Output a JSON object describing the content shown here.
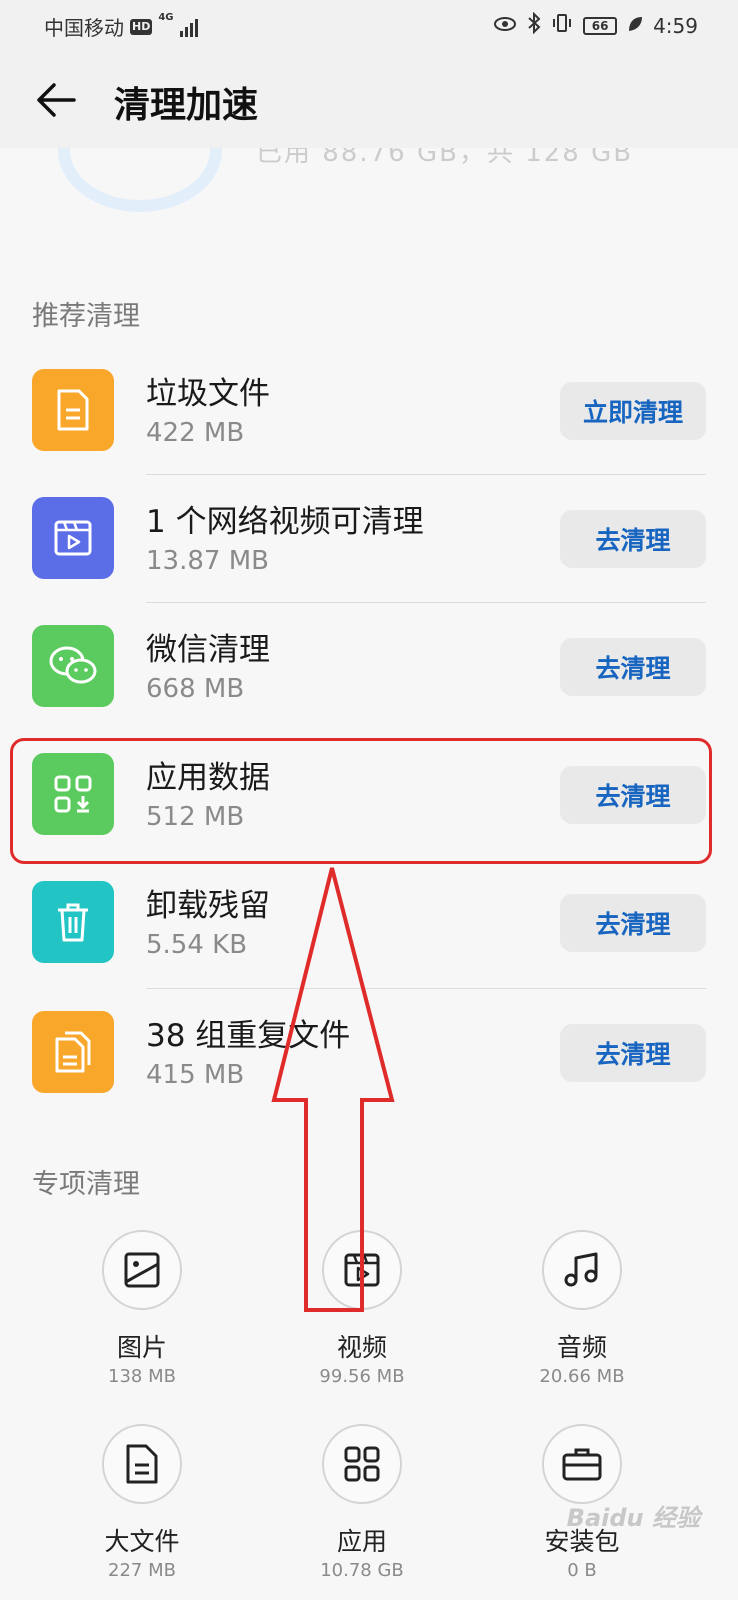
{
  "status_bar": {
    "carrier": "中国移动",
    "hd": "HD",
    "network": "4G",
    "battery": "66",
    "time": "4:59"
  },
  "appbar": {
    "title": "清理加速"
  },
  "header_partial": {
    "storage_text": "已用 88.76 GB，共 128 GB"
  },
  "recommended": {
    "section_title": "推荐清理",
    "items": [
      {
        "title": "垃圾文件",
        "size": "422 MB",
        "button": "立即清理",
        "icon": "document-icon",
        "color": "#f9a72b"
      },
      {
        "title": "1 个网络视频可清理",
        "size": "13.87 MB",
        "button": "去清理",
        "icon": "video-icon",
        "color": "#5b6ee8"
      },
      {
        "title": "微信清理",
        "size": "668 MB",
        "button": "去清理",
        "icon": "wechat-icon",
        "color": "#5ccb5f"
      },
      {
        "title": "应用数据",
        "size": "512 MB",
        "button": "去清理",
        "icon": "app-data-icon",
        "color": "#5ccb5f"
      },
      {
        "title": "卸载残留",
        "size": "5.54 KB",
        "button": "去清理",
        "icon": "trash-icon",
        "color": "#22c4c4"
      },
      {
        "title": "38 组重复文件",
        "size": "415 MB",
        "button": "去清理",
        "icon": "duplicate-files-icon",
        "color": "#f9a72b"
      }
    ]
  },
  "special": {
    "section_title": "专项清理",
    "items": [
      {
        "label": "图片",
        "size": "138 MB",
        "icon": "image-icon"
      },
      {
        "label": "视频",
        "size": "99.56 MB",
        "icon": "video-icon"
      },
      {
        "label": "音频",
        "size": "20.66 MB",
        "icon": "music-icon"
      },
      {
        "label": "大文件",
        "size": "227 MB",
        "icon": "file-icon"
      },
      {
        "label": "应用",
        "size": "10.78 GB",
        "icon": "apps-icon"
      },
      {
        "label": "安装包",
        "size": "0 B",
        "icon": "briefcase-icon"
      }
    ]
  },
  "watermark": "Baidu 经验",
  "colors": {
    "accent": "#1765c0",
    "annotation": "#e02b2b"
  }
}
